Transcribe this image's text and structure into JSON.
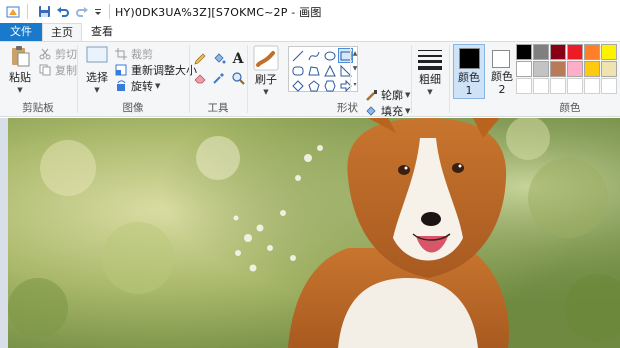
{
  "window": {
    "title": "HY)0DK3UA%3Z][S7OKMC~2P - 画图"
  },
  "tabs": {
    "file": "文件",
    "home": "主页",
    "view": "查看"
  },
  "clipboard": {
    "paste": "粘贴",
    "cut": "剪切",
    "copy": "复制",
    "label": "剪贴板"
  },
  "image": {
    "select": "选择",
    "crop": "裁剪",
    "resize": "重新调整大小",
    "rotate": "旋转",
    "label": "图像"
  },
  "tools": {
    "label": "工具"
  },
  "brushes": {
    "label": "刷子"
  },
  "shapes": {
    "outline": "轮廓",
    "fill": "填充",
    "label": "形状"
  },
  "size": {
    "label": "粗细"
  },
  "colors": {
    "color1": "颜色 1",
    "color2": "颜色 2",
    "label": "颜色",
    "color1_value": "#000000",
    "color2_value": "#ffffff",
    "palette": [
      "#000000",
      "#7f7f7f",
      "#880015",
      "#ed1c24",
      "#ff7f27",
      "#fff200",
      "#ffffff",
      "#c3c3c3",
      "#b97a57",
      "#ffaec9",
      "#ffc90e",
      "#efe4b0"
    ]
  }
}
